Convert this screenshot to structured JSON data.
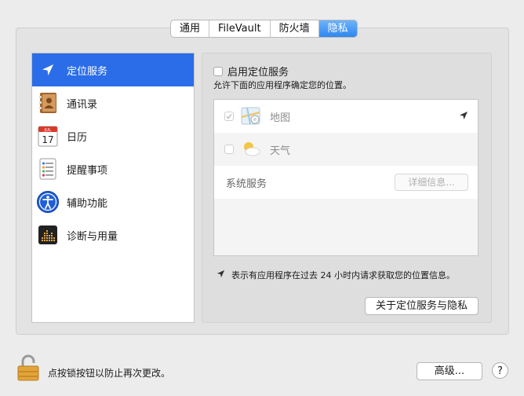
{
  "tabs": [
    {
      "label": "通用"
    },
    {
      "label": "FileVault"
    },
    {
      "label": "防火墙"
    },
    {
      "label": "隐私",
      "active": true
    }
  ],
  "sidebar": {
    "items": [
      {
        "label": "定位服务",
        "icon": "location-arrow-icon",
        "selected": true
      },
      {
        "label": "通讯录",
        "icon": "contacts-book-icon"
      },
      {
        "label": "日历",
        "icon": "calendar-icon"
      },
      {
        "label": "提醒事项",
        "icon": "reminders-list-icon"
      },
      {
        "label": "辅助功能",
        "icon": "accessibility-icon"
      },
      {
        "label": "诊断与用量",
        "icon": "diagnostics-icon"
      }
    ]
  },
  "calendar_icon": {
    "month": "JUL",
    "day": "17"
  },
  "location": {
    "enable_label": "启用定位服务",
    "enable_checked": false,
    "description": "允许下面的应用程序确定您的位置。",
    "apps": [
      {
        "name": "地图",
        "checked": true,
        "icon": "maps-icon",
        "recent_request": true
      },
      {
        "name": "天气",
        "checked": false,
        "icon": "weather-icon"
      }
    ],
    "system_services_label": "系统服务",
    "details_button": "详细信息...",
    "note": "表示有应用程序在过去 24 小时内请求获取您的位置信息。",
    "about_button": "关于定位服务与隐私"
  },
  "footer": {
    "lock_text": "点按锁按钮以防止再次更改。",
    "advanced_button": "高级...",
    "help_button": "?"
  },
  "colors": {
    "accent": "#2b6de8",
    "tab_active": "#3a8df2"
  }
}
